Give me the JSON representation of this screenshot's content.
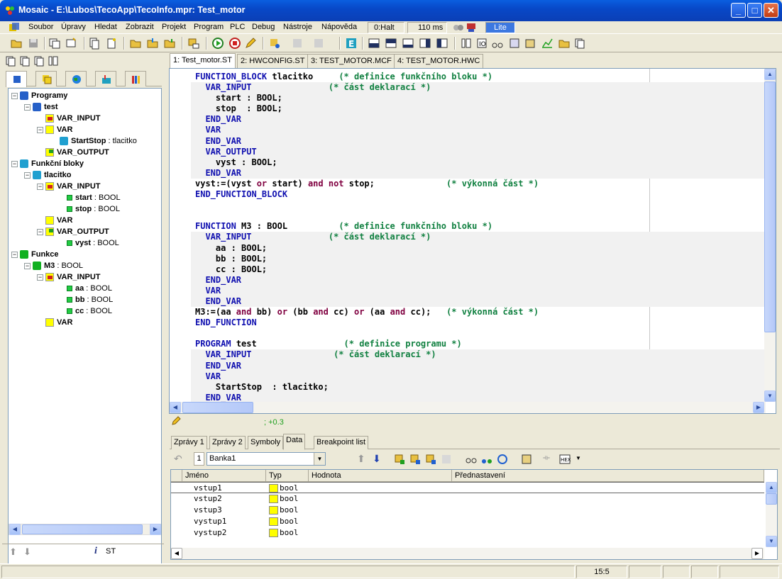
{
  "window": {
    "title": "Mosaic - E:\\Lubos\\TecoApp\\TecoInfo.mpr: Test_motor"
  },
  "menu": {
    "items": [
      "Soubor",
      "Úpravy",
      "Hledat",
      "Zobrazit",
      "Projekt",
      "Program",
      "PLC",
      "Debug",
      "Nástroje",
      "Nápověda"
    ],
    "status_halt": "0:Halt",
    "status_ms": "110 ms",
    "status_lite": "Lite"
  },
  "tree": {
    "programy": "Programy",
    "test": "test",
    "var_input": "VAR_INPUT",
    "var": "VAR",
    "startstop_name": "StartStop",
    "startstop_type": " : tlacitko",
    "var_output": "VAR_OUTPUT",
    "funkcni_bloky": "Funkční bloky",
    "tlacitko": "tlacitko",
    "start_name": "start",
    "start_type": " : BOOL",
    "stop_name": "stop",
    "stop_type": " : BOOL",
    "vyst_name": "vyst",
    "vyst_type": " : BOOL",
    "funkce": "Funkce",
    "m3_name": "M3",
    "m3_type": " : BOOL",
    "aa_name": "aa",
    "aa_type": " : BOOL",
    "bb_name": "bb",
    "bb_type": " : BOOL",
    "cc_name": "cc",
    "cc_type": " : BOOL"
  },
  "left_status": {
    "language": "ST"
  },
  "doc_tabs": [
    "1: Test_motor.ST",
    "2: HWCONFIG.ST",
    "3: TEST_MOTOR.MCF",
    "4: TEST_MOTOR.HWC"
  ],
  "editor": {
    "status_text": "; +0.3"
  },
  "bottom_tabs": [
    "Zprávy 1",
    "Zprávy 2",
    "Symboly",
    "Data",
    "Breakpoint list"
  ],
  "data_panel": {
    "bank_number": "1",
    "bank": "Banka1",
    "columns": [
      "Jméno",
      "Typ",
      "Hodnota",
      "Přednastavení"
    ],
    "rows": [
      {
        "name": "vstup1",
        "type": "bool"
      },
      {
        "name": "vstup2",
        "type": "bool"
      },
      {
        "name": "vstup3",
        "type": "bool"
      },
      {
        "name": "vystup1",
        "type": "bool"
      },
      {
        "name": "vystup2",
        "type": "bool"
      }
    ]
  },
  "statusbar": {
    "position": "15:5"
  }
}
